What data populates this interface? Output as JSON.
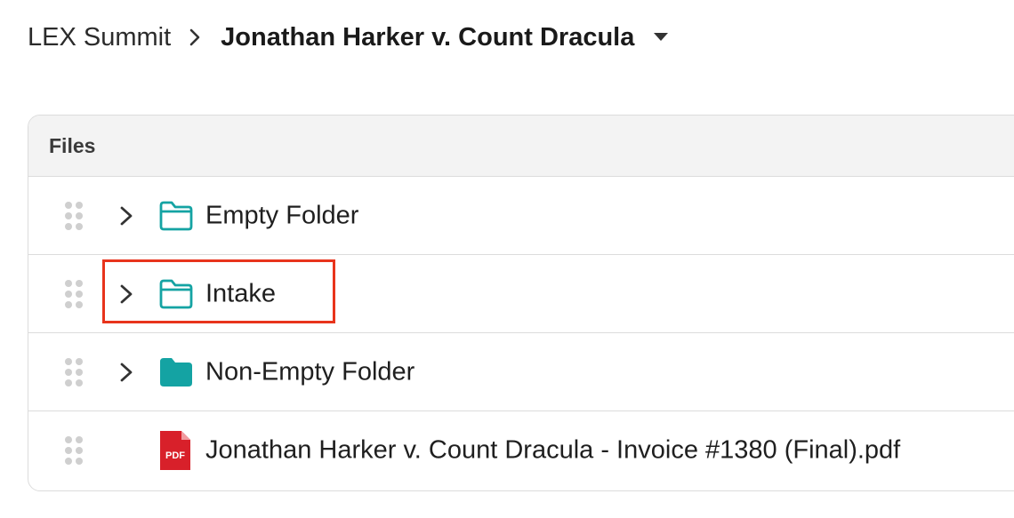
{
  "breadcrumb": {
    "root": "LEX Summit",
    "current": "Jonathan Harker v. Count Dracula",
    "separator_icon": "chevron-right-icon",
    "dropdown_icon": "caret-down-icon"
  },
  "files": {
    "header": "Files",
    "rows": [
      {
        "name": "Empty Folder",
        "type": "folder",
        "icon": "folder-outline-icon",
        "expandable": true
      },
      {
        "name": "Intake",
        "type": "folder",
        "icon": "folder-outline-icon",
        "expandable": true,
        "highlighted": true
      },
      {
        "name": "Non-Empty Folder",
        "type": "folder",
        "icon": "folder-filled-icon",
        "expandable": true
      },
      {
        "name": "Jonathan Harker v. Count Dracula - Invoice #1380 (Final).pdf",
        "type": "pdf",
        "icon": "pdf-file-icon",
        "expandable": false,
        "pdf_badge": "PDF"
      }
    ]
  },
  "colors": {
    "folder_teal": "#14a3a3",
    "pdf_red": "#d8202a",
    "highlight_red": "#e8341c",
    "header_bg": "#f3f3f3",
    "border": "#dcdcdc"
  }
}
